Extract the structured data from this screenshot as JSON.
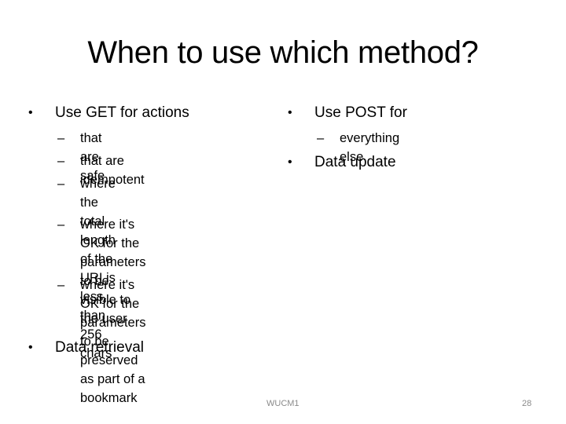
{
  "slide": {
    "title": "When to use which method?",
    "left_column": {
      "heading": "Use GET for actions",
      "subitems": [
        "that are safe",
        "that are idempotent",
        "where the total length of the\nURI is less than 256 chars",
        "where it's OK for the\nparameters to be visible to\nthe user",
        "where it's OK for the\nparameters to be preserved\nas part of a bookmark"
      ],
      "footer_bullet": "Data retrieval"
    },
    "right_column": {
      "heading": "Use POST for",
      "subitems": [
        "everything else"
      ],
      "second_bullet": "Data update"
    },
    "bullet_glyph": "•",
    "dash_glyph": "–",
    "footer": {
      "center": "WUCM1",
      "page_number": "28"
    }
  }
}
